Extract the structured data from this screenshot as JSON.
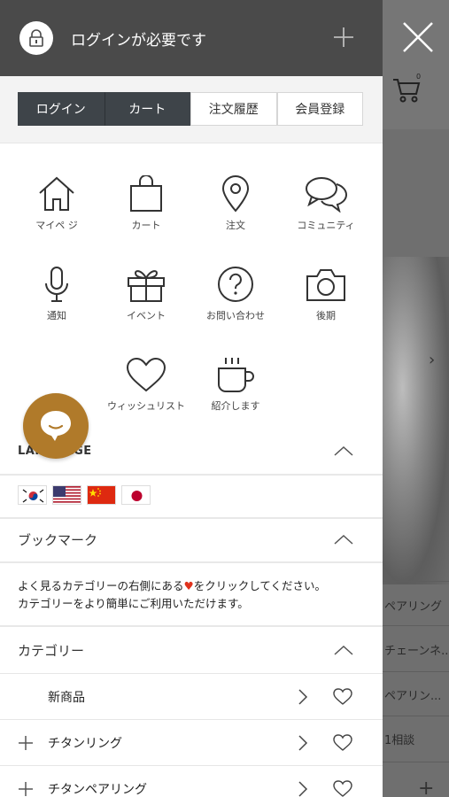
{
  "header": {
    "title": "ログインが必要です"
  },
  "tabs": [
    {
      "label": "ログイン",
      "active": true
    },
    {
      "label": "カート",
      "active": true
    },
    {
      "label": "注文履歴",
      "active": false
    },
    {
      "label": "会員登録",
      "active": false
    }
  ],
  "grid": [
    {
      "label": "マイペ ジ",
      "icon": "home-icon"
    },
    {
      "label": "カート",
      "icon": "shopping-bag-icon"
    },
    {
      "label": "注文",
      "icon": "location-pin-icon"
    },
    {
      "label": "コミュニティ",
      "icon": "chat-bubbles-icon"
    },
    {
      "label": "通知",
      "icon": "microphone-icon"
    },
    {
      "label": "イベント",
      "icon": "gift-icon"
    },
    {
      "label": "お問い合わせ",
      "icon": "question-icon"
    },
    {
      "label": "後期",
      "icon": "camera-icon"
    },
    {
      "label": "ウィッシュリスト",
      "icon": "heart-icon"
    },
    {
      "label": "紹介します",
      "icon": "coffee-cup-icon"
    }
  ],
  "language": {
    "title": "LANGUAGE",
    "flags": [
      "korea-flag",
      "usa-flag",
      "china-flag",
      "japan-flag"
    ]
  },
  "bookmark": {
    "title": "ブックマーク",
    "note_line1_pre": "よく見るカテゴリーの右側にある",
    "note_heart": "♥",
    "note_line1_post": "をクリックしてください。",
    "note_line2": "カテゴリーをより簡単にご利用いただけます。"
  },
  "category": {
    "title": "カテゴリー",
    "items": [
      {
        "label": "新商品",
        "expandable": false
      },
      {
        "label": "チタンリング",
        "expandable": true
      },
      {
        "label": "チタンペアリング",
        "expandable": true
      }
    ]
  },
  "background": {
    "texts": [
      "ペアリング",
      "チェーンネ...",
      "ペアリン...",
      "1相談"
    ],
    "cart_count": "0"
  },
  "colors": {
    "header_bg": "#4a4a4a",
    "tab_active_bg": "#3e4449",
    "chat_button": "#b07a2a",
    "heart_accent": "#e0321d"
  }
}
